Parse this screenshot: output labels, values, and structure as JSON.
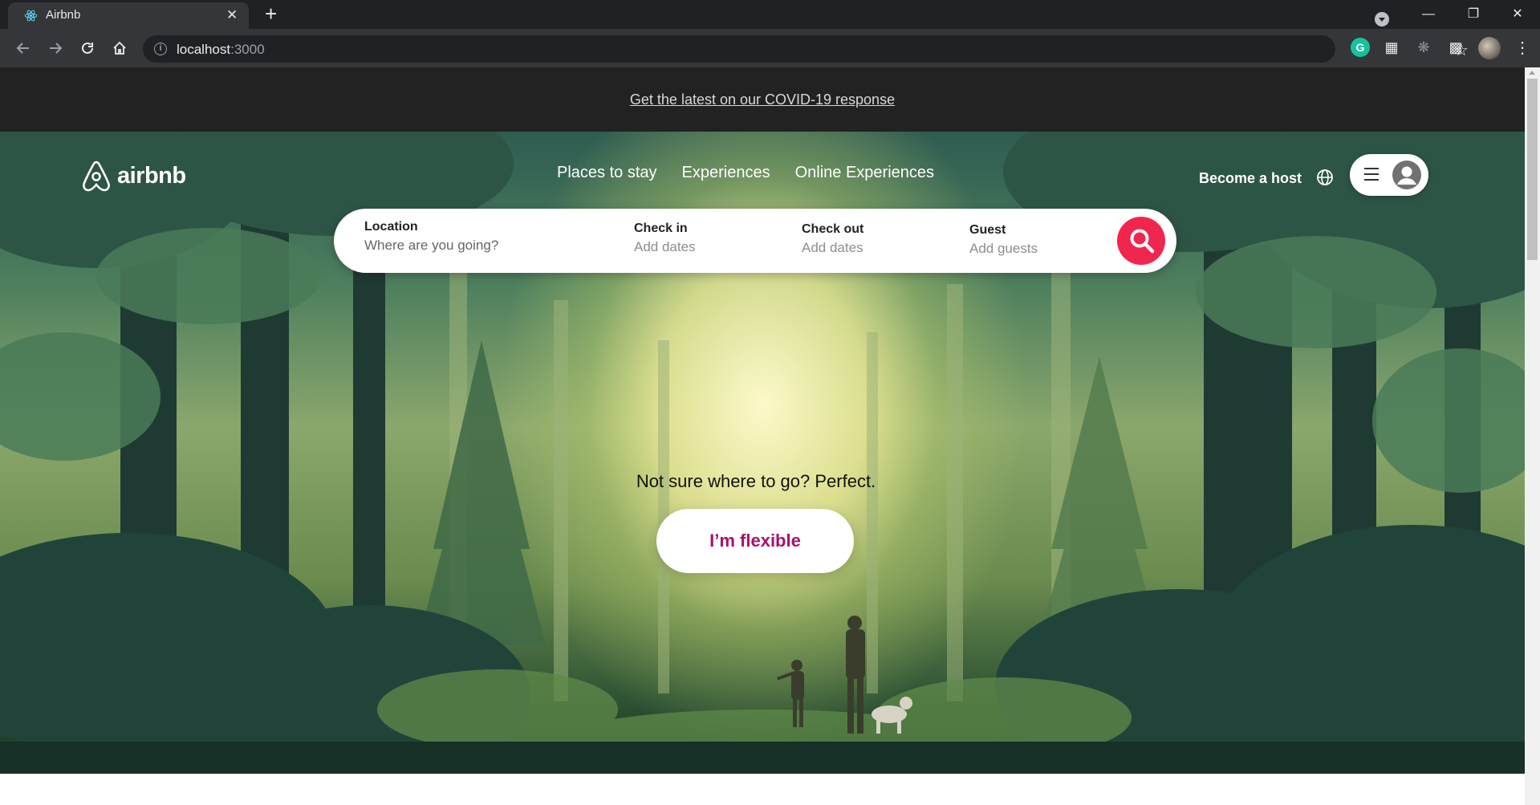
{
  "browser": {
    "tab_title": "Airbnb",
    "url_host": "localhost",
    "url_port": ":3000",
    "tab_close_glyph": "✕",
    "new_tab_glyph": "+",
    "extension_grammarly_letter": "G"
  },
  "banner": {
    "covid_link": "Get the latest on our COVID-19 response"
  },
  "header": {
    "logo_text": "airbnb",
    "nav": [
      "Places to stay",
      "Experiences",
      "Online Experiences"
    ],
    "become_host": "Become a host"
  },
  "search": {
    "location_label": "Location",
    "location_placeholder": "Where are you going?",
    "checkin_label": "Check in",
    "checkin_value": "Add dates",
    "checkout_label": "Check out",
    "checkout_value": "Add dates",
    "guest_label": "Guest",
    "guest_value": "Add guests"
  },
  "hero": {
    "prompt": "Not sure where to go? Perfect.",
    "flexible_button": "I’m flexible"
  },
  "colors": {
    "brand_pink": "#f0264f",
    "flexible_purple": "#a6106f",
    "banner_bg": "#222222"
  }
}
